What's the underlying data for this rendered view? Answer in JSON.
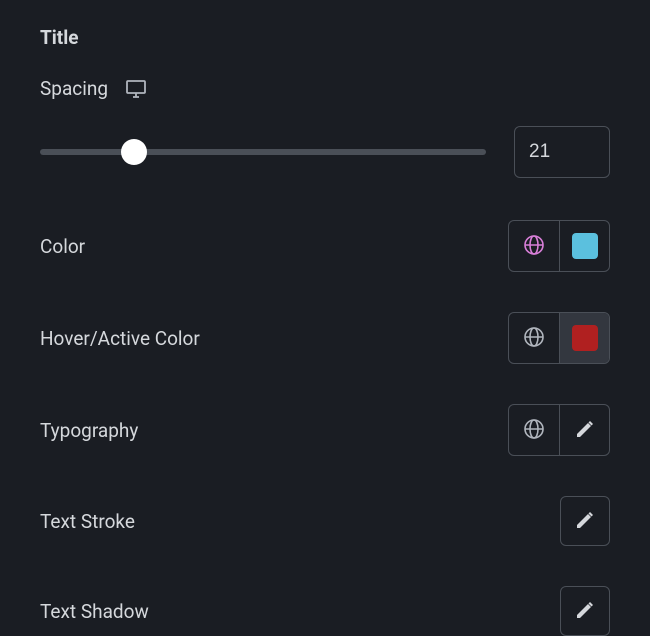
{
  "section": {
    "title": "Title"
  },
  "spacing": {
    "label": "Spacing",
    "value": "21",
    "slider_percent": 21
  },
  "color": {
    "label": "Color",
    "swatch": "#5bc0de",
    "globe_color": "#d87fd8"
  },
  "hover_color": {
    "label": "Hover/Active Color",
    "swatch": "#b02020",
    "globe_color": "#b0b5bd"
  },
  "typography": {
    "label": "Typography",
    "globe_color": "#b0b5bd"
  },
  "text_stroke": {
    "label": "Text Stroke"
  },
  "text_shadow": {
    "label": "Text Shadow"
  }
}
